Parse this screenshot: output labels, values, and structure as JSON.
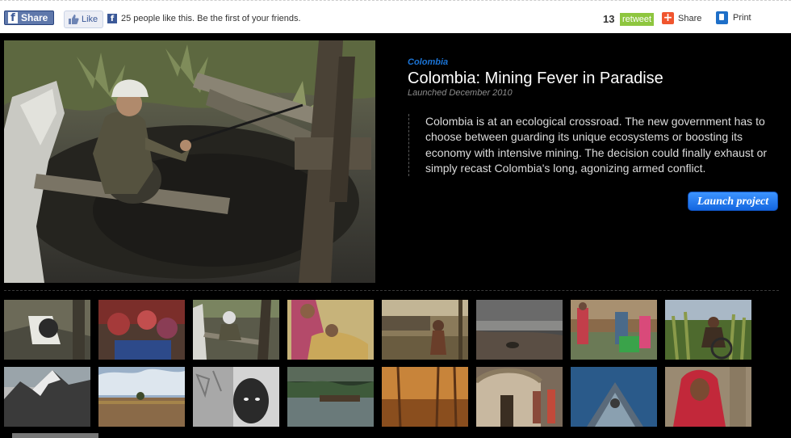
{
  "share_bar": {
    "facebook_share_label": "Share",
    "like_label": "Like",
    "like_text": "25 people like this. Be the first of your friends.",
    "tweet_count": "13",
    "retweet_label": "retweet",
    "share_label": "Share",
    "print_label": "Print"
  },
  "project": {
    "category": "Colombia",
    "title": "Colombia: Mining Fever in Paradise",
    "launched": "Launched December 2010",
    "description": "Colombia is at an ecological crossroad. The new government has to choose between guarding its unique ecosystems or boosting its economy with intensive mining. The decision could finally exhaust or simply recast Colombia's long, agonizing armed conflict.",
    "launch_label": "Launch project"
  },
  "thumbnails": {
    "count": 16
  },
  "colors": {
    "background": "#000000",
    "accent_blue": "#1b74d6",
    "facebook_blue": "#3b5998",
    "retweet_green": "#8ec63f",
    "share_orange": "#f0552e"
  },
  "icons": [
    "facebook-icon",
    "thumbs-up-icon",
    "facebook-mini-icon",
    "plus-icon",
    "print-icon"
  ]
}
